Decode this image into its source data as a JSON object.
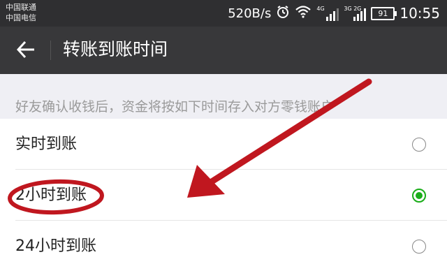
{
  "status_bar": {
    "carrier_1": "中国联通",
    "carrier_2": "中国电信",
    "net_speed": "520B/s",
    "sig1_label": "4G",
    "sig2_label": "3G 2G",
    "battery": "91",
    "time": "10:55",
    "icons": [
      "alarm-icon",
      "wifi-icon",
      "signal-icon",
      "battery-icon"
    ]
  },
  "title_bar": {
    "back_icon": "back-arrow-icon",
    "title": "转账到账时间"
  },
  "hint": "好友确认收钱后，资金将按如下时间存入对方零钱账户",
  "options": [
    {
      "label": "实时到账",
      "selected": false
    },
    {
      "label": "2小时到账",
      "selected": true
    },
    {
      "label": "24小时到账",
      "selected": false
    }
  ],
  "colors": {
    "status_bar_bg": "#2f2f31",
    "title_bar_bg": "#38383a",
    "hint_bg": "#efeff4",
    "radio_selected": "#1aad19",
    "annotation_red": "#c0171f"
  }
}
